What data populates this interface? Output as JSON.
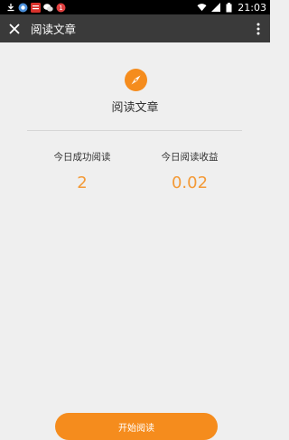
{
  "status_bar": {
    "time": "21:03",
    "notification_badge": "1",
    "icons": [
      "download-icon",
      "browser-icon",
      "news-app-icon",
      "wechat-icon",
      "notification-icon",
      "wifi-icon",
      "signal-icon",
      "battery-icon"
    ]
  },
  "app_bar": {
    "title": "阅读文章",
    "close_icon": "close-icon",
    "menu_icon": "more-vertical-icon"
  },
  "main": {
    "heading": "阅读文章",
    "stats": [
      {
        "label": "今日成功阅读",
        "value": "2"
      },
      {
        "label": "今日阅读收益",
        "value": "0.02"
      }
    ],
    "start_button_label": "开始阅读"
  },
  "colors": {
    "accent": "#f58c1d",
    "value_color": "#f39a37",
    "app_bar": "#3a3a3a",
    "background": "#efefef"
  }
}
